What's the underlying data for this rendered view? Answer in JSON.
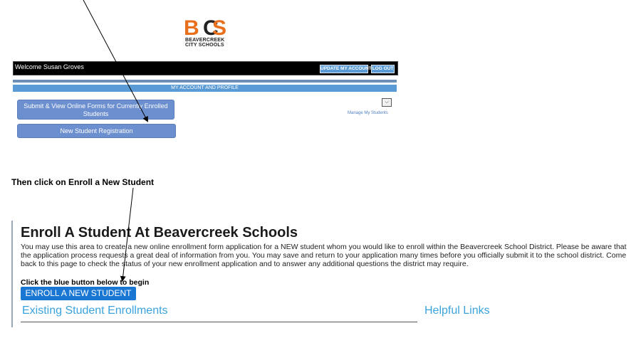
{
  "logo": {
    "letters": "BCS",
    "line1": "BEAVERCREEK",
    "line2": "CITY SCHOOLS"
  },
  "header": {
    "welcome": "Welcome Susan Groves",
    "update_account": "UPDATE MY ACCOUNT",
    "logout": "LOG OUT"
  },
  "account": {
    "title": "MY ACCOUNT AND PROFILE",
    "submit_forms": "Submit & View Online Forms for Currently Enrolled Students",
    "new_registration": "New Student Registration",
    "select_value": "",
    "manage_students": "Manage My Students"
  },
  "instruction": "Then click on Enroll a New Student",
  "enroll": {
    "title": "Enroll A Student At Beavercreek Schools",
    "description": "You may use this area to create a new online enrollment form application for a NEW student whom you would like to enroll within the Beavercreek School District. Please be aware that the application process requests a great deal of information from you. You may save and return to your application many times before you officially submit it to the school district. Come back to this page to check the status of your new enrollment application and to answer any additional questions the district may require.",
    "click_label": "Click the blue button below to begin",
    "button": "ENROLL A NEW STUDENT",
    "existing_heading": "Existing Student Enrollments",
    "helpful_heading": "Helpful Links"
  },
  "colors": {
    "brand_orange": "#e8701c",
    "header_blue": "#5b9bd5",
    "button_blue": "#1976d2",
    "heading_blue": "#3aa3dd"
  }
}
